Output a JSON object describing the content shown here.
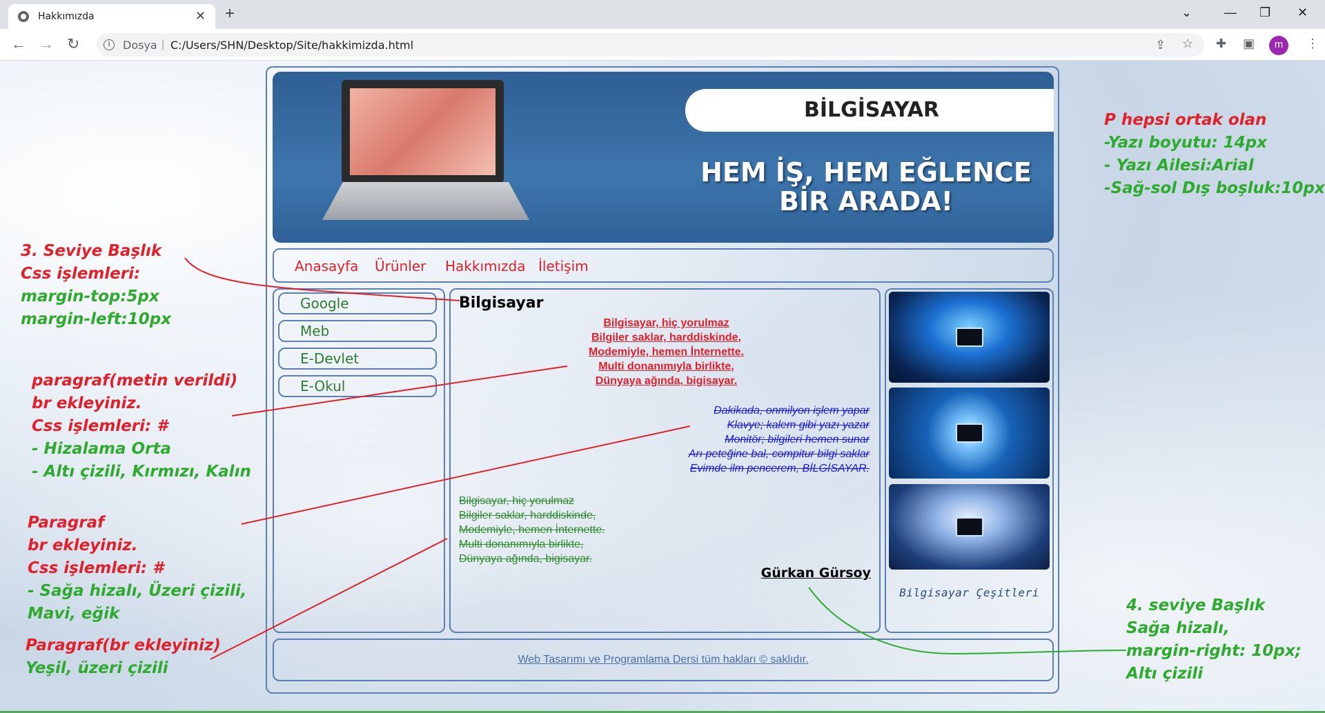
{
  "browser": {
    "tab_title": "Hakkımızda",
    "new_tab": "+",
    "address_label": "Dosya",
    "address_separator": "|",
    "url": "C:/Users/SHN/Desktop/Site/hakkimizda.html",
    "avatar_letter": "m"
  },
  "banner": {
    "title": "BİLGİSAYAR",
    "slogan_line1": "HEM İŞ, HEM EĞLENCE",
    "slogan_line2": "BİR ARADA!"
  },
  "nav": [
    "Anasayfa",
    "Ürünler",
    "Hakkımızda",
    "İletişim"
  ],
  "sidebar_links": [
    "Google",
    "Meb",
    "E-Devlet",
    "E-Okul"
  ],
  "content": {
    "heading": "Bilgisayar",
    "red_poem": [
      "Bilgisayar, hiç yorulmaz",
      "Bilgiler saklar, harddiskinde,",
      "Modemiyle, hemen İnternette.",
      "Multi donanımıyla birlikte,",
      "Dünyaya ağında, bigisayar."
    ],
    "blue_poem": [
      "Dakikada, onmilyon işlem yapar",
      "Klavye; kalem gibi yazı yazar",
      "Monitör; bilgileri hemen sunar",
      "Arı peteğine bal, compitur bilgi saklar",
      "Evimde ilm pencerem, BİLGİSAYAR."
    ],
    "green_poem": [
      "Bilgisayar, hiç yorulmaz",
      "Bilgiler saklar, harddiskinde,",
      "Modemiyle, hemen İnternette.",
      "Multi donanımıyla birlikte,",
      "Dünyaya ağında, bigisayar."
    ],
    "author": "Gürkan Gürsoy"
  },
  "right_column": {
    "caption": "Bilgisayar Çeşitleri"
  },
  "footer": "Web Tasarımı ve Programlama Dersi tüm hakları © saklıdır.",
  "annotations": {
    "top_right": {
      "title": "P hepsi ortak olan",
      "lines": [
        "-Yazı boyutu: 14px",
        "- Yazı Ailesi:Arial",
        "-Sağ-sol Dış boşluk:10px"
      ]
    },
    "h3": {
      "lines_red": [
        "3. Seviye Başlık",
        "Css işlemleri:"
      ],
      "lines_green": [
        "margin-top:5px",
        "margin-left:10px"
      ]
    },
    "p1": {
      "lines_red": [
        "paragraf(metin verildi)",
        "br ekleyiniz.",
        "Css işlemleri: #"
      ],
      "lines_green": [
        "- Hizalama Orta",
        "- Altı çizili, Kırmızı, Kalın"
      ]
    },
    "p2": {
      "lines_red": [
        "Paragraf",
        "br ekleyiniz.",
        "Css işlemleri: #"
      ],
      "lines_green": [
        "- Sağa hizalı, Üzeri çizili,",
        "Mavi, eğik"
      ]
    },
    "p3": {
      "line_red": "Paragraf(br ekleyiniz)",
      "line_green": "Yeşil, üzeri çizili"
    },
    "h4": {
      "lines": [
        "4. seviye Başlık",
        "Sağa hizalı,",
        "margin-right: 10px;",
        "Altı çizili"
      ]
    }
  },
  "colors": {
    "annotation_red": "#e0202a",
    "annotation_green": "#2eaa2e",
    "frame_border": "#5a7fb0",
    "nav_link": "#e0202a",
    "sidebar_link": "#2e7d32"
  },
  "icons": [
    "globe-icon",
    "close-icon",
    "back-icon",
    "forward-icon",
    "reload-icon",
    "info-icon",
    "share-icon",
    "star-icon",
    "extensions-icon",
    "sidepanel-icon",
    "menu-icon"
  ]
}
